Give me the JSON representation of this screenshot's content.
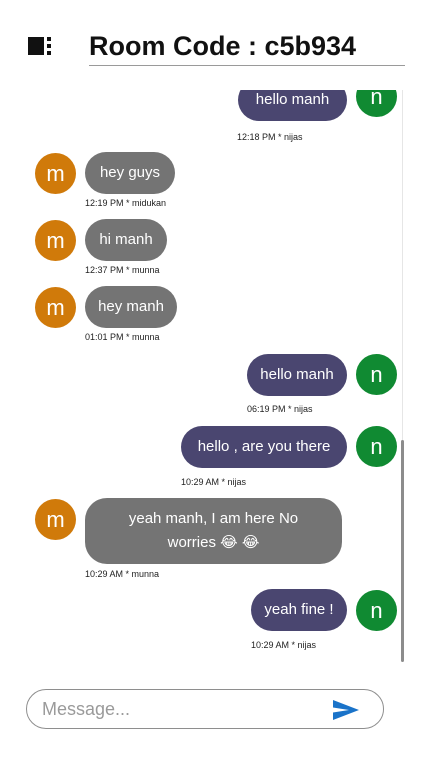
{
  "header": {
    "title": "Room Code : c5b934",
    "menu_icon": "sidebar-toggle-icon"
  },
  "messages": [
    {
      "side": "out",
      "avatar": "n",
      "text": "hello manh",
      "meta": "12:18 PM * nijas",
      "partial": true
    },
    {
      "side": "in",
      "avatar": "m",
      "text": "hey guys",
      "meta": "12:19 PM * midukan"
    },
    {
      "side": "in",
      "avatar": "m",
      "text": "hi manh",
      "meta": "12:37 PM * munna"
    },
    {
      "side": "in",
      "avatar": "m",
      "text": "hey manh",
      "meta": "01:01 PM * munna"
    },
    {
      "side": "out",
      "avatar": "n",
      "text": "hello manh",
      "meta": "06:19 PM * nijas"
    },
    {
      "side": "out",
      "avatar": "n",
      "text": "hello , are you there",
      "meta": "10:29 AM * nijas"
    },
    {
      "side": "in",
      "avatar": "m",
      "text": "yeah manh, I am here No worries 😂 😂",
      "meta": "10:29 AM * munna"
    },
    {
      "side": "out",
      "avatar": "n",
      "text": "yeah fine !",
      "meta": "10:29 AM * nijas"
    }
  ],
  "composer": {
    "placeholder": "Message...",
    "value": "",
    "send_icon": "send-icon"
  },
  "colors": {
    "incoming_bubble": "#747474",
    "outgoing_bubble": "#4a4670",
    "avatar_m": "#d07a0a",
    "avatar_n": "#108a32",
    "send_accent": "#1a73c9"
  }
}
